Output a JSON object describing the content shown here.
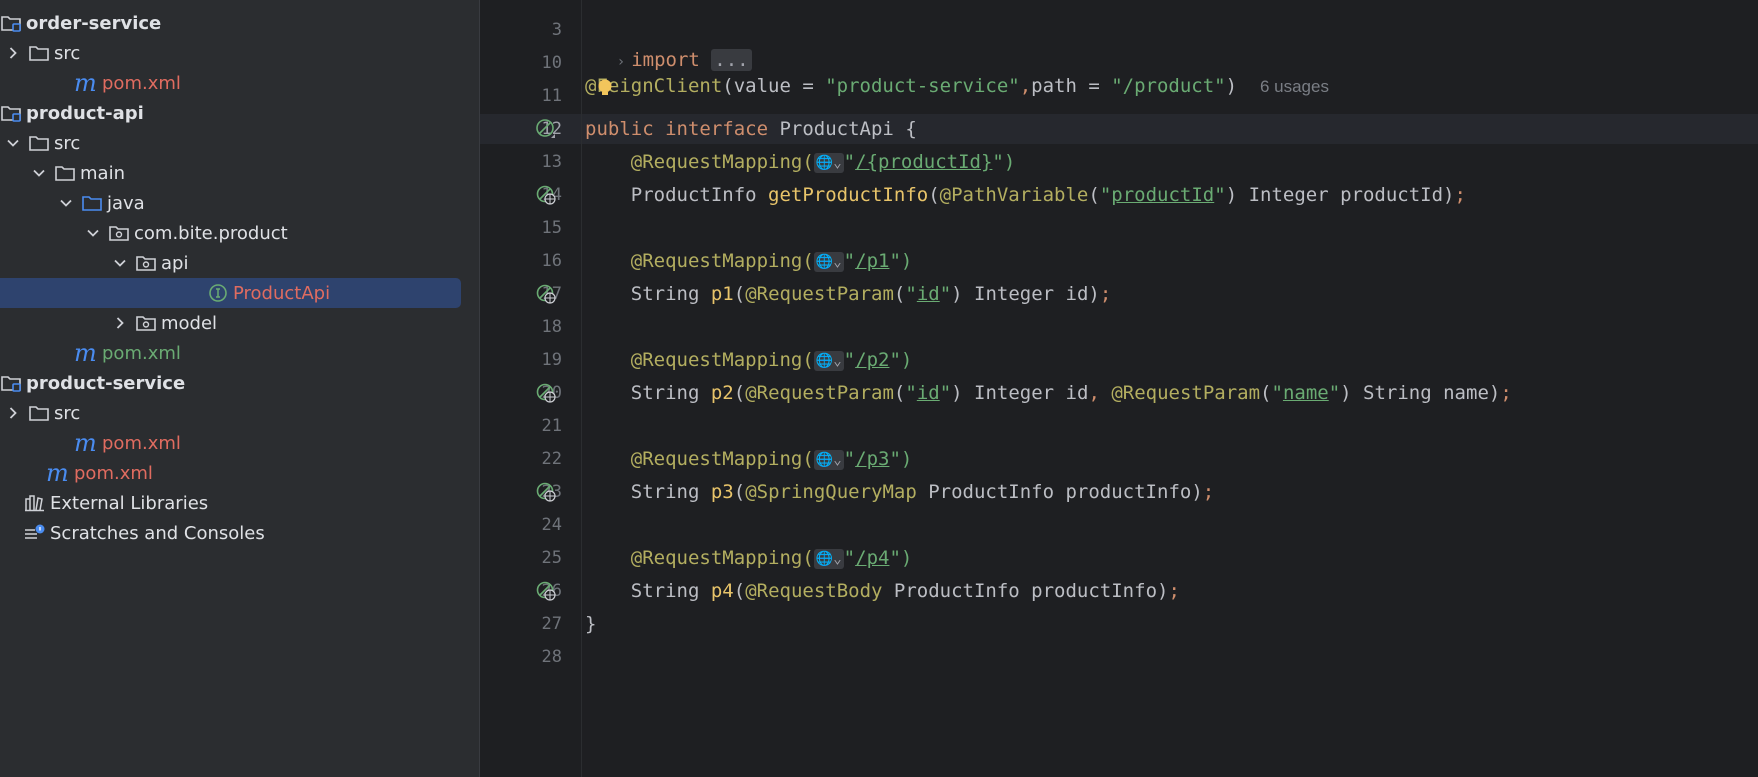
{
  "project_tree": {
    "items": [
      {
        "label": "order-service",
        "kind": "module",
        "style": "bold"
      },
      {
        "label": "src",
        "kind": "folder",
        "style": "normal"
      },
      {
        "label": "pom.xml",
        "kind": "maven",
        "style": "red"
      },
      {
        "label": "product-api",
        "kind": "module",
        "style": "bold"
      },
      {
        "label": "src",
        "kind": "folder",
        "style": "normal"
      },
      {
        "label": "main",
        "kind": "folder",
        "style": "normal"
      },
      {
        "label": "java",
        "kind": "source-folder",
        "style": "normal"
      },
      {
        "label": "com.bite.product",
        "kind": "package",
        "style": "normal"
      },
      {
        "label": "api",
        "kind": "package",
        "style": "normal"
      },
      {
        "label": "ProductApi",
        "kind": "interface",
        "style": "red"
      },
      {
        "label": "model",
        "kind": "package",
        "style": "normal"
      },
      {
        "label": "pom.xml",
        "kind": "maven",
        "style": "green"
      },
      {
        "label": "product-service",
        "kind": "module",
        "style": "bold"
      },
      {
        "label": "src",
        "kind": "folder",
        "style": "normal"
      },
      {
        "label": "pom.xml",
        "kind": "maven",
        "style": "red"
      },
      {
        "label": "pom.xml",
        "kind": "maven",
        "style": "red"
      },
      {
        "label": "External Libraries",
        "kind": "libraries",
        "style": "normal"
      },
      {
        "label": "Scratches and Consoles",
        "kind": "scratches",
        "style": "normal"
      }
    ],
    "selected": "ProductApi"
  },
  "editor": {
    "line_numbers": [
      "3",
      "10",
      "11",
      "12",
      "13",
      "14",
      "15",
      "16",
      "17",
      "18",
      "19",
      "20",
      "21",
      "22",
      "23",
      "24",
      "25",
      "26",
      "27",
      "28"
    ],
    "current_line": "12",
    "usages_hint": "6 usages",
    "fold_placeholder": "...",
    "tokens": {
      "import": "import",
      "feign_annotation": "@FeignClient",
      "feign_args_open": "(value = ",
      "feign_value": "\"product-service\"",
      "feign_comma": ",",
      "feign_path_key": "path = ",
      "feign_path": "\"/product\"",
      "feign_close": ")",
      "public": "public",
      "interface": "interface",
      "interface_name": " ProductApi {",
      "request_mapping": "@RequestMapping(",
      "globe": "🌐⌄",
      "quote": "\"",
      "close_paren": "\")",
      "path_product_id": "/{productId}",
      "path_p1": "/p1",
      "path_p2": "/p2",
      "path_p3": "/p3",
      "path_p4": "/p4",
      "type_product_info": "ProductInfo ",
      "method_get_product_info": "getProductInfo",
      "path_variable": "@PathVariable",
      "param_product_id": "productId",
      "integer_product_id": ") Integer productId)",
      "semicolon": ";",
      "string_type": "String ",
      "p1": "p1",
      "p2": "p2",
      "p3": "p3",
      "p4": "p4",
      "open_paren": "(",
      "request_param": "@RequestParam",
      "id": "id",
      "name": "name",
      "integer_id": ") Integer id)",
      "integer_id_comma": ") Integer id",
      "comma": ", ",
      "string_name": ") String name)",
      "spring_query_map": "@SpringQueryMap",
      "product_info_param": " ProductInfo productInfo)",
      "request_body": "@RequestBody",
      "closing_brace": "}"
    }
  }
}
